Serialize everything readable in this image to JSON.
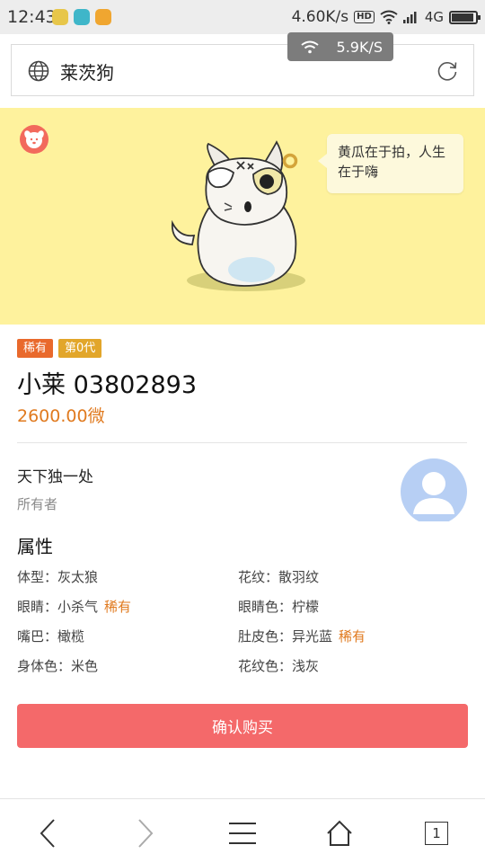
{
  "status_bar": {
    "time": "12:43",
    "net_speed": "4.60K/s",
    "hd_label": "HD",
    "network_type": "4G",
    "battery_level": 0.85
  },
  "toast": {
    "speed": "5.9K/S"
  },
  "address_bar": {
    "title": "莱茨狗"
  },
  "hero": {
    "bubble_text": "黄瓜在于拍，人生在于嗨"
  },
  "pet": {
    "tags": [
      "稀有",
      "第0代"
    ],
    "name": "小莱 03802893",
    "price": "2600.00微"
  },
  "owner": {
    "name": "天下独一处",
    "label": "所有者"
  },
  "attributes": {
    "title": "属性",
    "items": [
      {
        "label": "体型：灰太狼",
        "rare": ""
      },
      {
        "label": "花纹：散羽纹",
        "rare": ""
      },
      {
        "label": "眼睛：小杀气",
        "rare": "稀有"
      },
      {
        "label": "眼睛色：柠檬",
        "rare": ""
      },
      {
        "label": "嘴巴：橄榄",
        "rare": ""
      },
      {
        "label": "肚皮色：异光蓝",
        "rare": "稀有"
      },
      {
        "label": "身体色：米色",
        "rare": ""
      },
      {
        "label": "花纹色：浅灰",
        "rare": ""
      }
    ]
  },
  "buy_button": {
    "label": "确认购买"
  },
  "bottom_nav": {
    "tab_count": "1"
  },
  "colors": {
    "hero_bg": "#fef29d",
    "accent_orange": "#e07a1f",
    "buy_button": "#f4696a",
    "rare_tag": "#e9692c",
    "gen_tag": "#e2a62a"
  }
}
